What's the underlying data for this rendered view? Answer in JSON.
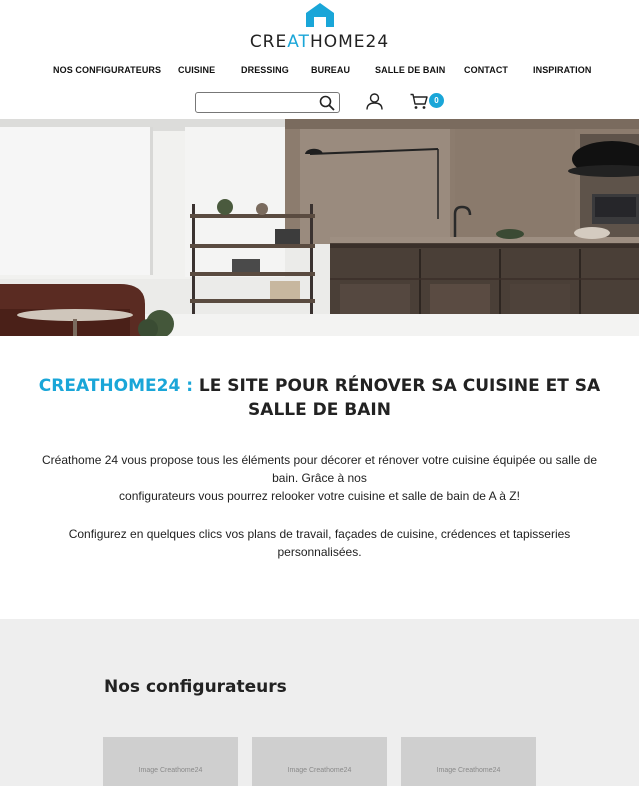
{
  "header": {
    "logo": {
      "prefix": "CRE",
      "accent": "AT",
      "suffix": "HOME24",
      "icon": "house-icon"
    },
    "nav": [
      "NOS CONFIGURATEURS",
      "CUISINE",
      "DRESSING",
      "BUREAU",
      "SALLE DE BAIN",
      "CONTACT",
      "INSPIRATION"
    ],
    "search": {
      "placeholder": "",
      "value": "",
      "icon": "search-icon"
    },
    "user_icon": "user-icon",
    "cart": {
      "icon": "cart-icon",
      "count": "0"
    }
  },
  "hero": {
    "image": "kitchen-photo"
  },
  "intro": {
    "title_brand": "CREATHOME24 :",
    "title_rest": " LE SITE POUR RÉNOVER SA CUISINE ET SA SALLE DE BAIN",
    "paragraph1_line1": "Créathome 24 vous propose tous les éléments pour décorer et rénover votre cuisine équipée ou salle de bain. Grâce à nos",
    "paragraph1_line2": "configurateurs vous pourrez relooker votre cuisine et salle de bain de A à Z!",
    "paragraph2": "Configurez en quelques clics vos plans de travail, façades de cuisine, crédences et tapisseries personnalisées."
  },
  "configurators": {
    "title": "Nos configurateurs",
    "cards": [
      {
        "label": "Image Creathome24"
      },
      {
        "label": "Image Creathome24"
      },
      {
        "label": "Image Creathome24"
      }
    ]
  },
  "colors": {
    "accent": "#1aa6d8",
    "text": "#222222",
    "section_bg": "#eeeeee"
  }
}
